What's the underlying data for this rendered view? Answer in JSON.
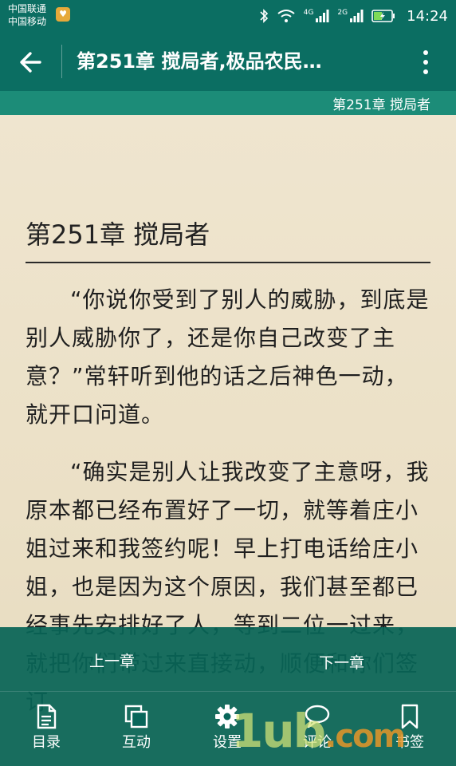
{
  "status": {
    "carrier_1": "中国联通",
    "carrier_2": "中国移动",
    "net_1": "4G",
    "net_2": "2G",
    "time": "14:24"
  },
  "header": {
    "title": "第251章 搅局者,极品农民…",
    "chapter_strip": "第251章 搅局者"
  },
  "content": {
    "chapter_title": "第251章 搅局者",
    "paragraphs": [
      "“你说你受到了别人的威胁，到底是别人威胁你了，还是你自己改变了主意？”常轩听到他的话之后神色一动，就开口问道。",
      "“确实是别人让我改变了主意呀，我原本都已经布置好了一切，就等着庄小姐过来和我签约呢！早上打电话给庄小姐，也是因为这个原因，我们甚至都已经事先安排好了人，等到二位一过来，就把你们带过来直接动，顺便和你们签订"
    ]
  },
  "chapter_nav": {
    "prev_label": "上一章",
    "next_label": "下一章"
  },
  "toolbar": {
    "items": [
      {
        "label": "目录",
        "icon": "document-icon"
      },
      {
        "label": "互动",
        "icon": "copy-icon"
      },
      {
        "label": "设置",
        "icon": "gear-icon"
      },
      {
        "label": "评论",
        "icon": "comment-icon"
      },
      {
        "label": "书签",
        "icon": "bookmark-icon"
      }
    ]
  },
  "watermark": {
    "text": "1ub",
    "suffix": ".com"
  },
  "colors": {
    "bar": "#0b6e62",
    "strip": "#1c8c78",
    "paper": "#ece3cc"
  }
}
